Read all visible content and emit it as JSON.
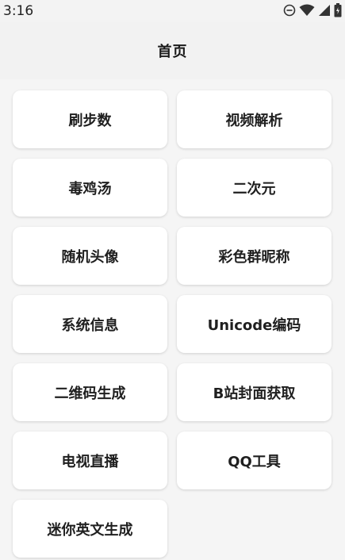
{
  "status_bar": {
    "time": "3:16",
    "icons": [
      "do-not-disturb-icon",
      "wifi-icon",
      "signal-icon",
      "battery-icon"
    ]
  },
  "app_bar": {
    "title": "首页"
  },
  "menu": {
    "items": [
      {
        "label": "刷步数"
      },
      {
        "label": "视频解析"
      },
      {
        "label": "毒鸡汤"
      },
      {
        "label": "二次元"
      },
      {
        "label": "随机头像"
      },
      {
        "label": "彩色群昵称"
      },
      {
        "label": "系统信息"
      },
      {
        "label": "Unicode编码"
      },
      {
        "label": "二维码生成"
      },
      {
        "label": "B站封面获取"
      },
      {
        "label": "电视直播"
      },
      {
        "label": "QQ工具"
      },
      {
        "label": "迷你英文生成"
      }
    ]
  },
  "colors": {
    "background": "#f5f5f5",
    "card": "#ffffff",
    "text": "#1f1f1f"
  }
}
